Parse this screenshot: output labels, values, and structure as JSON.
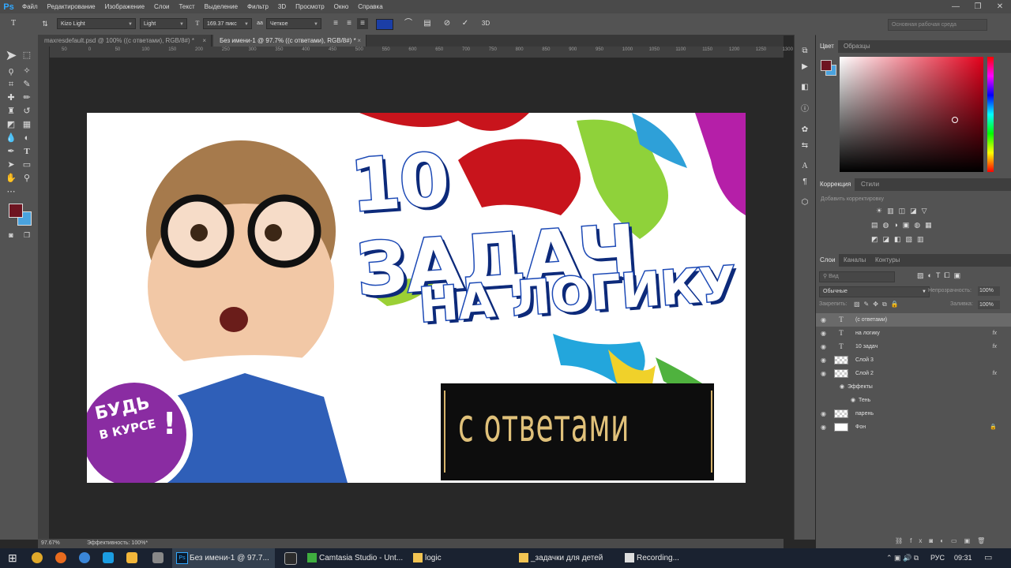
{
  "app": {
    "logo": "Ps",
    "menu": [
      "Файл",
      "Редактирование",
      "Изображение",
      "Слои",
      "Текст",
      "Выделение",
      "Фильтр",
      "3D",
      "Просмотр",
      "Окно",
      "Справка"
    ],
    "window_controls": [
      "—",
      "❐",
      "✕"
    ]
  },
  "options_bar": {
    "font_family": "Kizo Light",
    "font_style": "Light",
    "font_size": "169.37 пикс",
    "antialias_icon": "aa",
    "antialias": "Четкое",
    "text_color": "#1b3ea6",
    "three_d": "3D",
    "workspace": "Основная рабочая среда"
  },
  "tabs": [
    {
      "label": "maxresdefault.psd @ 100% ((с ответами), RGB/8#) *",
      "close": "×"
    },
    {
      "label": "Без имени-1 @ 97.7% ((с ответами), RGB/8#) *",
      "close": "×"
    }
  ],
  "ruler": {
    "ticks": [
      "50",
      "0",
      "50",
      "100",
      "150",
      "200",
      "250",
      "300",
      "350",
      "400",
      "450",
      "500",
      "550",
      "600",
      "650",
      "700",
      "750",
      "800",
      "850",
      "900",
      "950",
      "1000",
      "1050",
      "1100",
      "1150",
      "1200",
      "1250",
      "1300"
    ]
  },
  "canvas": {
    "headline_1": "10 ЗАДАЧ",
    "headline_2": "НА ЛОГИКУ",
    "badge_line1": "БУДЬ",
    "badge_line2": "В КУРСЕ",
    "badge_exclaim": "!",
    "answers_text": "с ответами"
  },
  "status": {
    "zoom": "97.67%",
    "efficiency": "Эффективность: 100%*"
  },
  "colors": {
    "foreground": "#6e1421",
    "background": "#4aa3df"
  },
  "color_panel": {
    "tabs": [
      "Цвет",
      "Образцы"
    ]
  },
  "adjust_panel": {
    "tabs": [
      "Коррекция",
      "Стили"
    ],
    "hint": "Добавить корректировку"
  },
  "layers_panel": {
    "tabs": [
      "Слои",
      "Каналы",
      "Контуры"
    ],
    "search": "Вид",
    "blend_mode": "Обычные",
    "opacity_label": "Непрозрачность:",
    "opacity": "100%",
    "lock_label": "Закрепить:",
    "fill_label": "Заливка:",
    "fill": "100%",
    "layers": [
      {
        "name": "(с ответами)",
        "kind": "T",
        "fx": "",
        "selected": true
      },
      {
        "name": "на логику",
        "kind": "T",
        "fx": "fx",
        "selected": false
      },
      {
        "name": "10 задач",
        "kind": "T",
        "fx": "fx",
        "selected": false
      },
      {
        "name": "Слой 3",
        "kind": "img",
        "fx": "",
        "selected": false
      },
      {
        "name": "Слой 2",
        "kind": "img",
        "fx": "fx",
        "selected": false
      },
      {
        "name": "Эффекты",
        "kind": "sub",
        "fx": "",
        "selected": false
      },
      {
        "name": "Тень",
        "kind": "sub2",
        "fx": "",
        "selected": false
      },
      {
        "name": "парень",
        "kind": "img",
        "fx": "",
        "selected": false
      },
      {
        "name": "Фон",
        "kind": "bg",
        "fx": "",
        "selected": false
      }
    ]
  },
  "taskbar": {
    "items": [
      "Без имени-1 @ 97.7...",
      "Camtasia Studio - Unt...",
      "logic",
      "_задачки для детей",
      "Recording..."
    ],
    "lang": "РУС",
    "time": "09:31"
  }
}
